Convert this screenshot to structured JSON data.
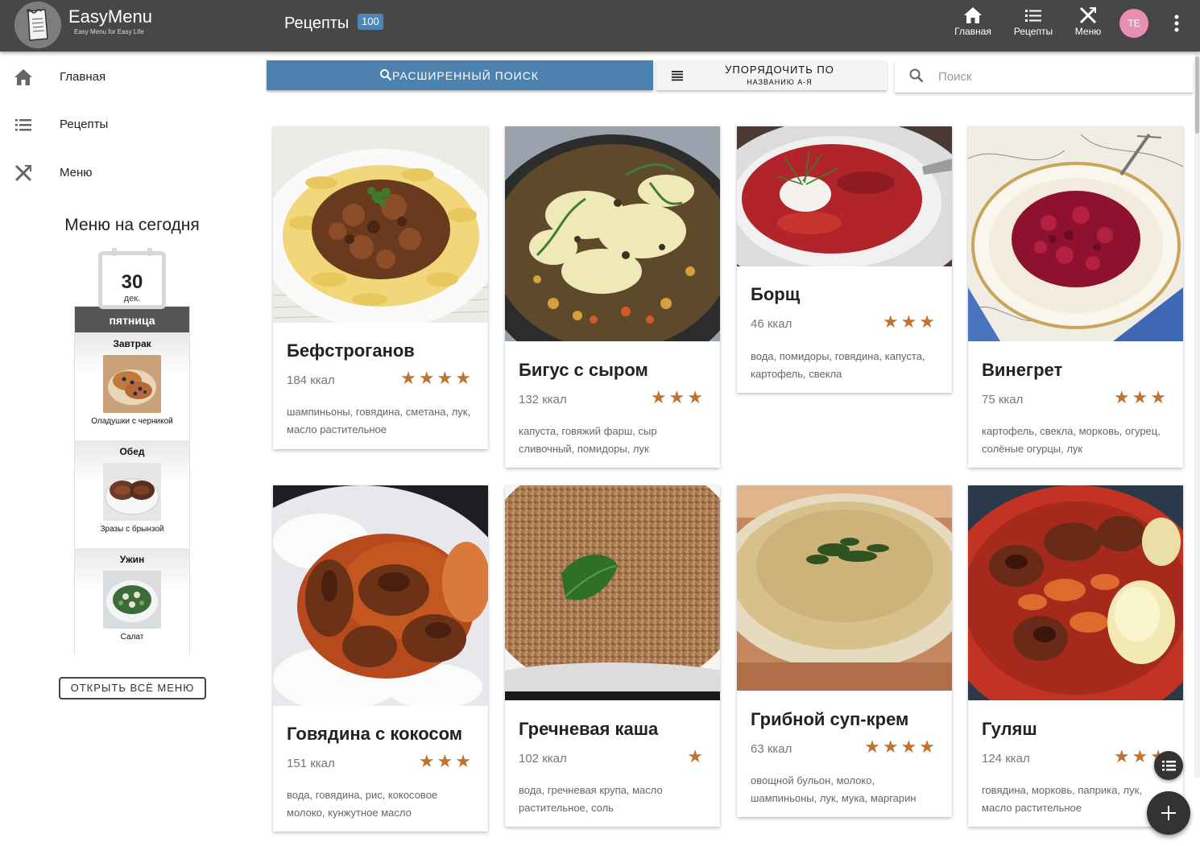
{
  "app": {
    "name": "EasyMenu",
    "tagline": "Easy Menu for Easy Life"
  },
  "header": {
    "title": "Рецепты",
    "count": "100",
    "nav": [
      {
        "label": "Главная",
        "icon": "home-icon"
      },
      {
        "label": "Рецепты",
        "icon": "list-icon"
      },
      {
        "label": "Меню",
        "icon": "utensils-icon"
      }
    ],
    "avatar_initials": "TE"
  },
  "sidebar": {
    "items": [
      {
        "label": "Главная",
        "icon": "home-icon"
      },
      {
        "label": "Рецепты",
        "icon": "list-icon"
      },
      {
        "label": "Меню",
        "icon": "utensils-icon"
      }
    ],
    "today_title": "Меню на сегодня",
    "calendar": {
      "day": "30",
      "month": "дек.",
      "weekday": "пятница"
    },
    "meals": [
      {
        "name": "Завтрак",
        "dish": "Оладушки с черникой"
      },
      {
        "name": "Обед",
        "dish": "Зразы с брынзой"
      },
      {
        "name": "Ужин",
        "dish": "Салат"
      }
    ],
    "open_menu_label": "ОТКРЫТЬ ВСЁ МЕНЮ"
  },
  "toolbar": {
    "advanced_search_label": "РАСШИРЕННЫЙ ПОИСК",
    "sort_label": "УПОРЯДОЧИТЬ ПО",
    "sort_value": "НАЗВАНИЮ А-Я",
    "search_placeholder": "Поиск"
  },
  "recipes": [
    {
      "name": "Бефстроганов",
      "kcal": "184 ккал",
      "rating": 4,
      "stars": "★★★★",
      "ingredients": "шампиньоны, говядина, сметана, лук, масло растительное"
    },
    {
      "name": "Бигус с сыром",
      "kcal": "132 ккал",
      "rating": 3,
      "stars": "★★★",
      "ingredients": "капуста, говяжий фарш, сыр сливочный, помидоры, лук"
    },
    {
      "name": "Борщ",
      "kcal": "46 ккал",
      "rating": 3,
      "stars": "★★★",
      "ingredients": "вода, помидоры, говядина, капуста, картофель, свекла"
    },
    {
      "name": "Винегрет",
      "kcal": "75 ккал",
      "rating": 3,
      "stars": "★★★",
      "ingredients": "картофель, свекла, морковь, огурец, солёные огурцы, лук"
    },
    {
      "name": "Говядина с кокосом",
      "kcal": "151 ккал",
      "rating": 3,
      "stars": "★★★",
      "ingredients": "вода, говядина, рис, кокосовое молоко, кунжутное масло"
    },
    {
      "name": "Гречневая каша",
      "kcal": "102 ккал",
      "rating": 1,
      "stars": "★",
      "ingredients": "вода, гречневая крупа, масло растительное, соль"
    },
    {
      "name": "Грибной суп-крем",
      "kcal": "63 ккал",
      "rating": 4,
      "stars": "★★★★",
      "ingredients": "овощной бульон, молоко, шампиньоны, лук, мука, маргарин"
    },
    {
      "name": "Гуляш",
      "kcal": "124 ккал",
      "rating": 3,
      "stars": "★★★",
      "ingredients": "говядина, морковь, паприка, лук, масло растительное"
    }
  ],
  "colors": {
    "topbar": "#474747",
    "accent": "#4c82ad",
    "star": "#c0732e",
    "avatar": "#e88fb2"
  }
}
